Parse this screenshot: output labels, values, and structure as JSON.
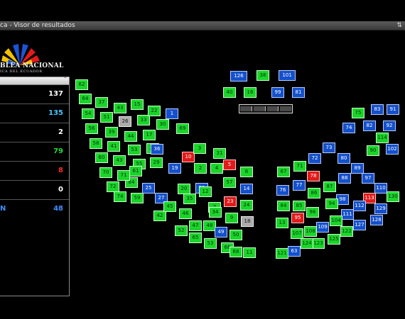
{
  "window": {
    "title": "ca - Visor de resultados",
    "control_glyph": "⇅"
  },
  "logo": {
    "name": "BLEA NACIONAL",
    "subtitle": "ICA DEL ECUADOR"
  },
  "results_panel": {
    "rows": [
      {
        "value": "137",
        "color": "#ffffff"
      },
      {
        "value": "135",
        "color": "#44c8ff"
      },
      {
        "value": "2",
        "color": "#ffffff"
      },
      {
        "value": "79",
        "color": "#22dd33"
      },
      {
        "value": "8",
        "color": "#ff2a2a"
      },
      {
        "value": "0",
        "color": "#ffffff"
      },
      {
        "label": "N",
        "value": "48",
        "color": "#3f8fff"
      }
    ]
  },
  "colors": {
    "green": "#1ad42a",
    "blue": "#1450cc",
    "red": "#e21a1a",
    "gray": "#aaaaaa"
  },
  "seats": [
    [
      "126",
      "blue"
    ],
    [
      "38",
      "green"
    ],
    [
      "101",
      "blue"
    ],
    [
      "40",
      "green"
    ],
    [
      "16",
      "green"
    ],
    [
      "99",
      "blue"
    ],
    [
      "81",
      "blue"
    ],
    [
      "62",
      "green"
    ],
    [
      "64",
      "green"
    ],
    [
      "54",
      "green"
    ],
    [
      "56",
      "green"
    ],
    [
      "58",
      "green"
    ],
    [
      "60",
      "green"
    ],
    [
      "70",
      "green"
    ],
    [
      "72",
      "green"
    ],
    [
      "74",
      "green"
    ],
    [
      "84",
      "green"
    ],
    [
      "37",
      "green"
    ],
    [
      "51",
      "green"
    ],
    [
      "39",
      "green"
    ],
    [
      "41",
      "green"
    ],
    [
      "43",
      "green"
    ],
    [
      "71",
      "green"
    ],
    [
      "59",
      "green"
    ],
    [
      "43",
      "green"
    ],
    [
      "26",
      "gray"
    ],
    [
      "44",
      "green"
    ],
    [
      "53",
      "green"
    ],
    [
      "55",
      "green"
    ],
    [
      "61",
      "green"
    ],
    [
      "15",
      "green"
    ],
    [
      "33",
      "green"
    ],
    [
      "17",
      "green"
    ],
    [
      "28",
      "green"
    ],
    [
      "29",
      "green"
    ],
    [
      "22",
      "green"
    ],
    [
      "30",
      "green"
    ],
    [
      "36",
      "blue"
    ],
    [
      "1",
      "blue"
    ],
    [
      "69",
      "green"
    ],
    [
      "10",
      "red"
    ],
    [
      "19",
      "blue"
    ],
    [
      "25",
      "blue"
    ],
    [
      "27",
      "blue"
    ],
    [
      "42",
      "green"
    ],
    [
      "3",
      "green"
    ],
    [
      "2",
      "green"
    ],
    [
      "20",
      "green"
    ],
    [
      "45",
      "green"
    ],
    [
      "46",
      "green"
    ],
    [
      "31",
      "green"
    ],
    [
      "35",
      "green"
    ],
    [
      "21",
      "blue"
    ],
    [
      "4",
      "green"
    ],
    [
      "12",
      "green"
    ],
    [
      "7",
      "green"
    ],
    [
      "5",
      "red"
    ],
    [
      "57",
      "green"
    ],
    [
      "6",
      "green"
    ],
    [
      "14",
      "blue"
    ],
    [
      "23",
      "red"
    ],
    [
      "24",
      "green"
    ],
    [
      "47",
      "green"
    ],
    [
      "48",
      "green"
    ],
    [
      "34",
      "green"
    ],
    [
      "9",
      "green"
    ],
    [
      "18",
      "gray"
    ],
    [
      "49",
      "blue"
    ],
    [
      "50",
      "green"
    ],
    [
      "52",
      "green"
    ],
    [
      "65",
      "green"
    ],
    [
      "53",
      "green"
    ],
    [
      "66",
      "green"
    ],
    [
      "68",
      "green"
    ],
    [
      "11",
      "green"
    ],
    [
      "75",
      "green"
    ],
    [
      "83",
      "blue"
    ],
    [
      "91",
      "blue"
    ],
    [
      "74",
      "blue"
    ],
    [
      "82",
      "blue"
    ],
    [
      "92",
      "blue"
    ],
    [
      "114",
      "green"
    ],
    [
      "90",
      "green"
    ],
    [
      "102",
      "blue"
    ],
    [
      "73",
      "blue"
    ],
    [
      "72",
      "blue"
    ],
    [
      "80",
      "blue"
    ],
    [
      "67",
      "green"
    ],
    [
      "71",
      "green"
    ],
    [
      "78",
      "red"
    ],
    [
      "89",
      "blue"
    ],
    [
      "88",
      "blue"
    ],
    [
      "97",
      "blue"
    ],
    [
      "110",
      "blue"
    ],
    [
      "76",
      "blue"
    ],
    [
      "77",
      "blue"
    ],
    [
      "86",
      "green"
    ],
    [
      "87",
      "green"
    ],
    [
      "98",
      "blue"
    ],
    [
      "113",
      "red"
    ],
    [
      "130",
      "green"
    ],
    [
      "84",
      "green"
    ],
    [
      "85",
      "green"
    ],
    [
      "96",
      "green"
    ],
    [
      "94",
      "green"
    ],
    [
      "111",
      "blue"
    ],
    [
      "112",
      "blue"
    ],
    [
      "129",
      "blue"
    ],
    [
      "13",
      "green"
    ],
    [
      "95",
      "red"
    ],
    [
      "109",
      "blue"
    ],
    [
      "104",
      "green"
    ],
    [
      "127",
      "blue"
    ],
    [
      "128",
      "blue"
    ],
    [
      "107",
      "green"
    ],
    [
      "108",
      "green"
    ],
    [
      "122",
      "green"
    ],
    [
      "123",
      "green"
    ],
    [
      "125",
      "green"
    ],
    [
      "121",
      "green"
    ],
    [
      "63",
      "blue"
    ],
    [
      "124",
      "green"
    ]
  ]
}
